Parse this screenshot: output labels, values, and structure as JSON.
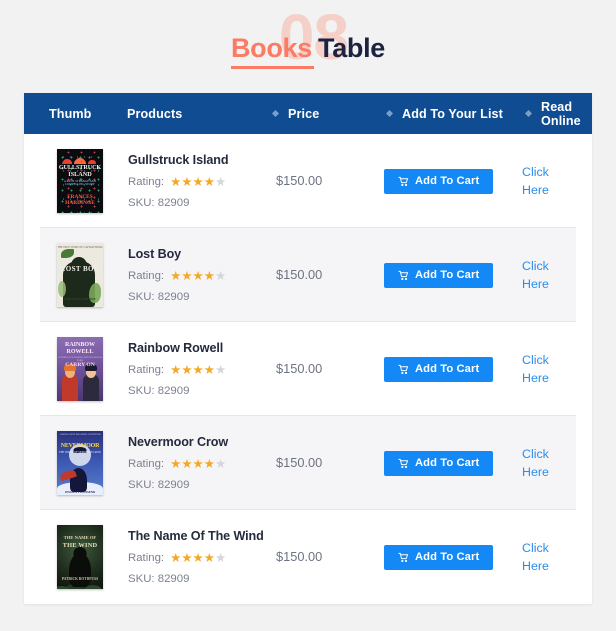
{
  "logo": {
    "ghost_number": "08",
    "word_primary": "Books",
    "word_secondary": "Table"
  },
  "table": {
    "columns": [
      {
        "key": "thumb",
        "label": "Thumb",
        "bullet": false
      },
      {
        "key": "products",
        "label": "Products",
        "bullet": false
      },
      {
        "key": "price",
        "label": "Price",
        "bullet": true
      },
      {
        "key": "cart",
        "label": "Add To Your List",
        "bullet": true
      },
      {
        "key": "read",
        "label": "Read Online",
        "bullet": true
      }
    ],
    "rating_label": "Rating:",
    "sku_prefix": "SKU:",
    "cart_button_label": "Add To Cart",
    "read_link_label": "Click Here",
    "rows": [
      {
        "title": "Gullstruck Island",
        "rating": 4,
        "rating_max": 5,
        "sku": "SKU: 82909",
        "price": "$150.00",
        "cart_label": "Add To Cart",
        "read_label": "Click Here",
        "cover": {
          "style": "cv1",
          "line1": "GULLSTRUCK",
          "line2": "ISLAND",
          "line3": "A RICH, STRANGE AND COMPELLING STORY",
          "line4": "FRANCES",
          "line5": "HARDINGE"
        }
      },
      {
        "title": "Lost Boy",
        "rating": 4,
        "rating_max": 5,
        "sku": "SKU: 82909",
        "price": "$150.00",
        "cart_label": "Add To Cart",
        "read_label": "Click Here",
        "cover": {
          "style": "cv2",
          "line1": "LOST BOY",
          "line2": "THE TRUE STORY OF CAPTAIN HOOK",
          "line3": "CHRISTINA HENRY"
        }
      },
      {
        "title": "Rainbow Rowell",
        "rating": 4,
        "rating_max": 5,
        "sku": "SKU: 82909",
        "price": "$150.00",
        "cart_label": "Add To Cart",
        "read_label": "Click Here",
        "cover": {
          "style": "cv3",
          "line1": "RAINBOW",
          "line2": "ROWELL",
          "line3": "AUTHOR OF FANGIRL AND ELEANOR & PARK",
          "line4": "CARRY ON"
        }
      },
      {
        "title": "Nevermoor Crow",
        "rating": 4,
        "rating_max": 5,
        "sku": "SKU: 82909",
        "price": "$150.00",
        "cart_label": "Add To Cart",
        "read_label": "Click Here",
        "cover": {
          "style": "cv4",
          "line1": "NEVERMOOR",
          "line2": "THE TRIALS OF MORRIGAN CROW",
          "line3": "A BRILLIANTLY IMAGINED ADVENTURE",
          "line4": "JESSICA TOWNSEND"
        }
      },
      {
        "title": "The Name Of The Wind",
        "rating": 4,
        "rating_max": 5,
        "sku": "SKU: 82909",
        "price": "$150.00",
        "cart_label": "Add To Cart",
        "read_label": "Click Here",
        "cover": {
          "style": "cv5",
          "line1": "THE NAME OF",
          "line2": "THE WIND",
          "line3": "PATRICK ROTHFUSS"
        }
      }
    ]
  },
  "colors": {
    "page_background": "#f2f2f2",
    "card_background": "#ffffff",
    "header_background": "#0f4c92",
    "header_text": "#ffffff",
    "accent_coral": "#fb7b65",
    "logo_dark": "#1b2340",
    "button_blue": "#1489f5",
    "link_blue": "#2a8df0",
    "star_on": "#f6a821",
    "star_off": "#d4d6dc",
    "row_alt_background": "#f5f5f7",
    "row_separator": "#e6e6e8",
    "title_text": "#242b3d",
    "muted_text": "#7b8190"
  }
}
